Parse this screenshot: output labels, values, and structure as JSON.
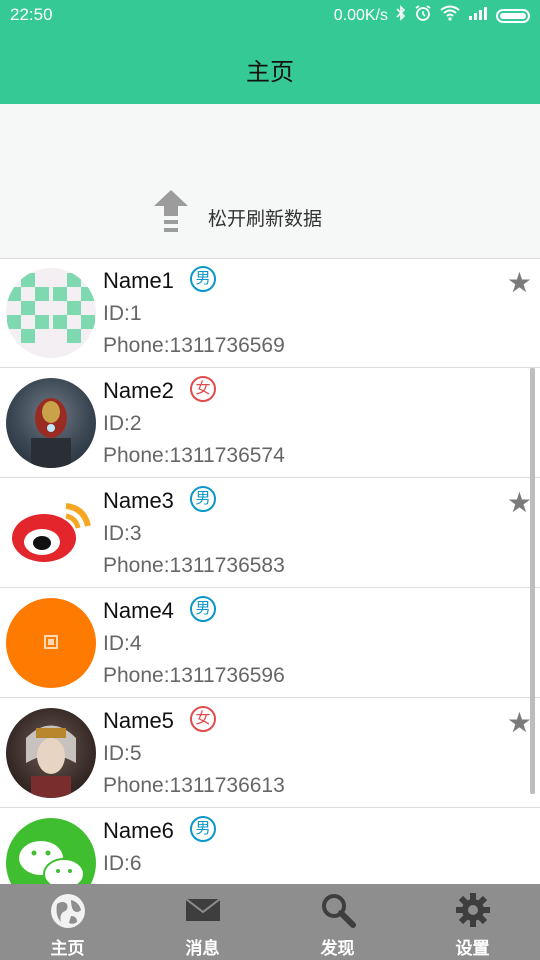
{
  "status_bar": {
    "time": "22:50",
    "network_speed": "0.00K/s",
    "icons": [
      "bluetooth-icon",
      "alarm-icon",
      "wifi-icon",
      "signal-icon",
      "battery-icon"
    ]
  },
  "app_bar": {
    "title": "主页"
  },
  "refresh_header": {
    "text": "松开刷新数据",
    "icon": "up-arrow-icon"
  },
  "contacts": [
    {
      "name": "Name1",
      "gender": "男",
      "id": "ID:1",
      "phone": "Phone:1311736569",
      "starred": true,
      "avatar": "mosaic-avatar"
    },
    {
      "name": "Name2",
      "gender": "女",
      "id": "ID:2",
      "phone": "Phone:1311736574",
      "starred": false,
      "avatar": "ironman-avatar"
    },
    {
      "name": "Name3",
      "gender": "男",
      "id": "ID:3",
      "phone": "Phone:1311736583",
      "starred": true,
      "avatar": "weibo-avatar"
    },
    {
      "name": "Name4",
      "gender": "男",
      "id": "ID:4",
      "phone": "Phone:1311736596",
      "starred": false,
      "avatar": "orange-avatar"
    },
    {
      "name": "Name5",
      "gender": "女",
      "id": "ID:5",
      "phone": "Phone:1311736613",
      "starred": true,
      "avatar": "character-avatar"
    },
    {
      "name": "Name6",
      "gender": "男",
      "id": "ID:6",
      "phone": "",
      "starred": false,
      "avatar": "wechat-avatar"
    }
  ],
  "tab_bar": {
    "tabs": [
      {
        "label": "主页",
        "icon": "globe-icon"
      },
      {
        "label": "消息",
        "icon": "envelope-icon"
      },
      {
        "label": "发现",
        "icon": "magnifier-icon"
      },
      {
        "label": "设置",
        "icon": "gear-icon"
      }
    ]
  },
  "colors": {
    "accent": "#35c995",
    "male": "#0a97c9",
    "female": "#e24b4b",
    "tabbar": "#8e8e8e"
  }
}
